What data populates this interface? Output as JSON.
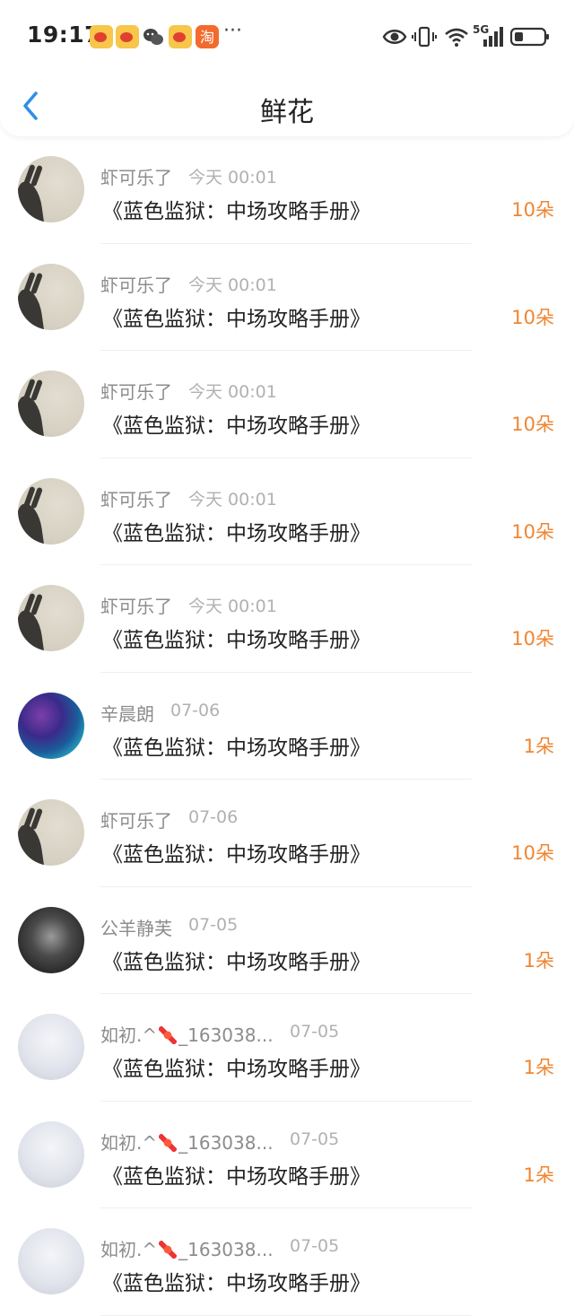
{
  "status_bar": {
    "time": "19:17",
    "more": "···",
    "network": "5G"
  },
  "header": {
    "title": "鲜花"
  },
  "colors": {
    "accent": "#2f8fe6",
    "amount": "#f08530"
  },
  "items": [
    {
      "name": "虾可乐了",
      "date": "今天 00:01",
      "book": "《蓝色监狱：中场攻略手册》",
      "amount": "10朵",
      "avatar": "beige"
    },
    {
      "name": "虾可乐了",
      "date": "今天 00:01",
      "book": "《蓝色监狱：中场攻略手册》",
      "amount": "10朵",
      "avatar": "beige"
    },
    {
      "name": "虾可乐了",
      "date": "今天 00:01",
      "book": "《蓝色监狱：中场攻略手册》",
      "amount": "10朵",
      "avatar": "beige"
    },
    {
      "name": "虾可乐了",
      "date": "今天 00:01",
      "book": "《蓝色监狱：中场攻略手册》",
      "amount": "10朵",
      "avatar": "beige"
    },
    {
      "name": "虾可乐了",
      "date": "今天 00:01",
      "book": "《蓝色监狱：中场攻略手册》",
      "amount": "10朵",
      "avatar": "beige"
    },
    {
      "name": "辛晨朗",
      "date": "07-06",
      "book": "《蓝色监狱：中场攻略手册》",
      "amount": "1朵",
      "avatar": "galaxy"
    },
    {
      "name": "虾可乐了",
      "date": "07-06",
      "book": "《蓝色监狱：中场攻略手册》",
      "amount": "10朵",
      "avatar": "beige"
    },
    {
      "name": "公羊静芙",
      "date": "07-05",
      "book": "《蓝色监狱：中场攻略手册》",
      "amount": "1朵",
      "avatar": "mono"
    },
    {
      "name": "如初.^",
      "name_suffix": "_163038...",
      "date": "07-05",
      "book": "《蓝色监狱：中场攻略手册》",
      "amount": "1朵",
      "avatar": "light"
    },
    {
      "name": "如初.^",
      "name_suffix": "_163038...",
      "date": "07-05",
      "book": "《蓝色监狱：中场攻略手册》",
      "amount": "1朵",
      "avatar": "light"
    },
    {
      "name": "如初.^",
      "name_suffix": "_163038...",
      "date": "07-05",
      "book": "《蓝色监狱：中场攻略手册》",
      "amount": "",
      "avatar": "light"
    }
  ]
}
